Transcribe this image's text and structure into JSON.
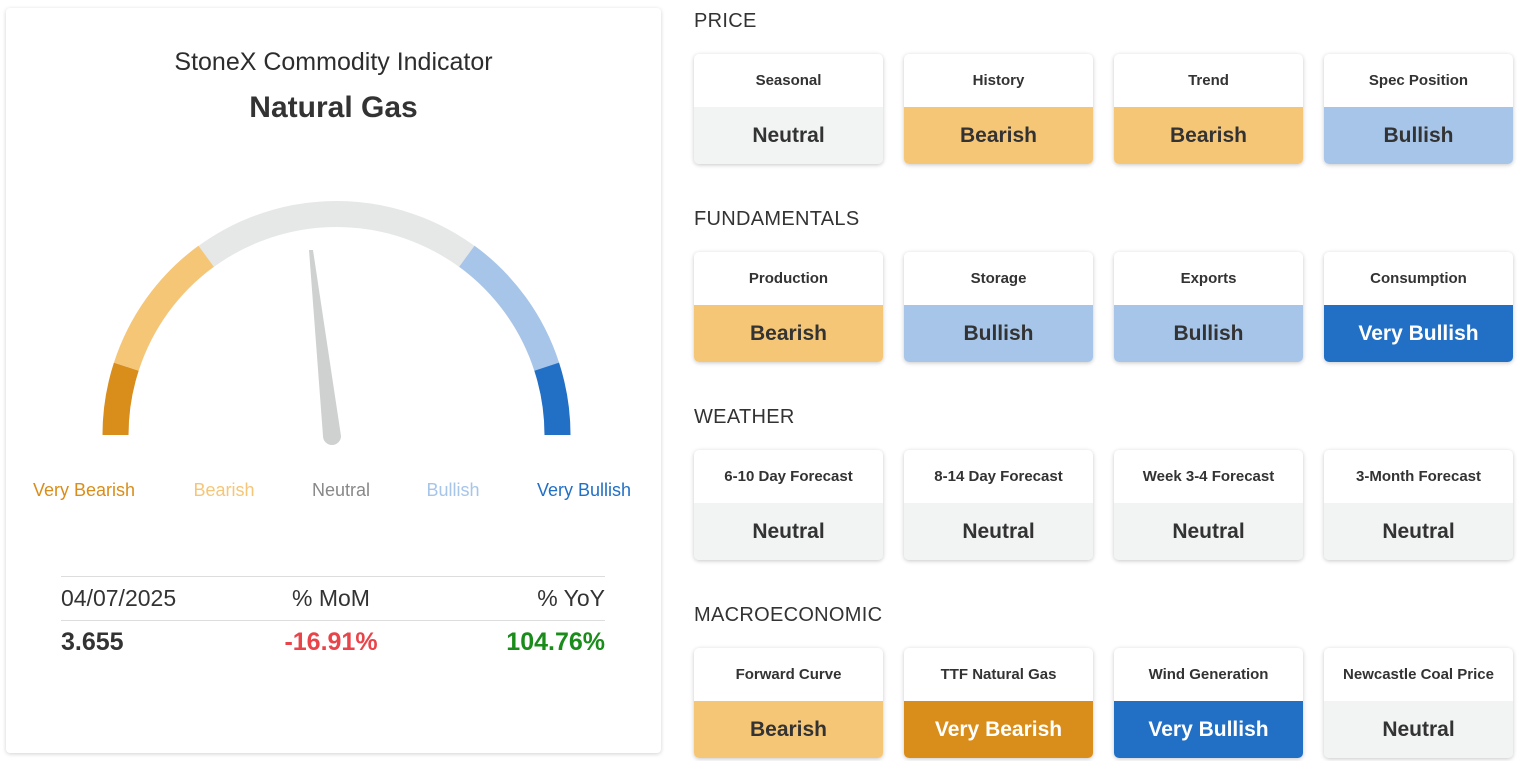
{
  "indicator": {
    "title": "StoneX Commodity Indicator",
    "commodity": "Natural Gas"
  },
  "gauge": {
    "current_value": "Neutral",
    "labels": [
      {
        "text": "Very Bearish",
        "color": "#d98d1a"
      },
      {
        "text": "Bearish",
        "color": "#f6c677"
      },
      {
        "text": "Neutral",
        "color": "#888888"
      },
      {
        "text": "Bullish",
        "color": "#a6c5e9"
      },
      {
        "text": "Very Bullish",
        "color": "#2170c6"
      }
    ]
  },
  "stats": {
    "date": "04/07/2025",
    "mom_label": "% MoM",
    "yoy_label": "% YoY",
    "price": "3.655",
    "mom": "-16.91%",
    "yoy": "104.76%",
    "mom_color": "#e8444a",
    "yoy_color": "#1a8c1a"
  },
  "sections": [
    {
      "title": "PRICE",
      "tiles": [
        {
          "label": "Seasonal",
          "value": "Neutral",
          "status": "neutral"
        },
        {
          "label": "History",
          "value": "Bearish",
          "status": "bearish"
        },
        {
          "label": "Trend",
          "value": "Bearish",
          "status": "bearish"
        },
        {
          "label": "Spec Position",
          "value": "Bullish",
          "status": "bullish"
        }
      ]
    },
    {
      "title": "FUNDAMENTALS",
      "tiles": [
        {
          "label": "Production",
          "value": "Bearish",
          "status": "bearish"
        },
        {
          "label": "Storage",
          "value": "Bullish",
          "status": "bullish"
        },
        {
          "label": "Exports",
          "value": "Bullish",
          "status": "bullish"
        },
        {
          "label": "Consumption",
          "value": "Very Bullish",
          "status": "vbullish"
        }
      ]
    },
    {
      "title": "WEATHER",
      "tiles": [
        {
          "label": "6-10 Day Forecast",
          "value": "Neutral",
          "status": "neutral"
        },
        {
          "label": "8-14 Day Forecast",
          "value": "Neutral",
          "status": "neutral"
        },
        {
          "label": "Week 3-4 Forecast",
          "value": "Neutral",
          "status": "neutral"
        },
        {
          "label": "3-Month Forecast",
          "value": "Neutral",
          "status": "neutral"
        }
      ]
    },
    {
      "title": "MACROECONOMIC",
      "tiles": [
        {
          "label": "Forward Curve",
          "value": "Bearish",
          "status": "bearish"
        },
        {
          "label": "TTF Natural Gas",
          "value": "Very Bearish",
          "status": "vbearish"
        },
        {
          "label": "Wind Generation",
          "value": "Very Bullish",
          "status": "vbullish"
        },
        {
          "label": "Newcastle Coal Price",
          "value": "Neutral",
          "status": "neutral"
        }
      ]
    }
  ]
}
